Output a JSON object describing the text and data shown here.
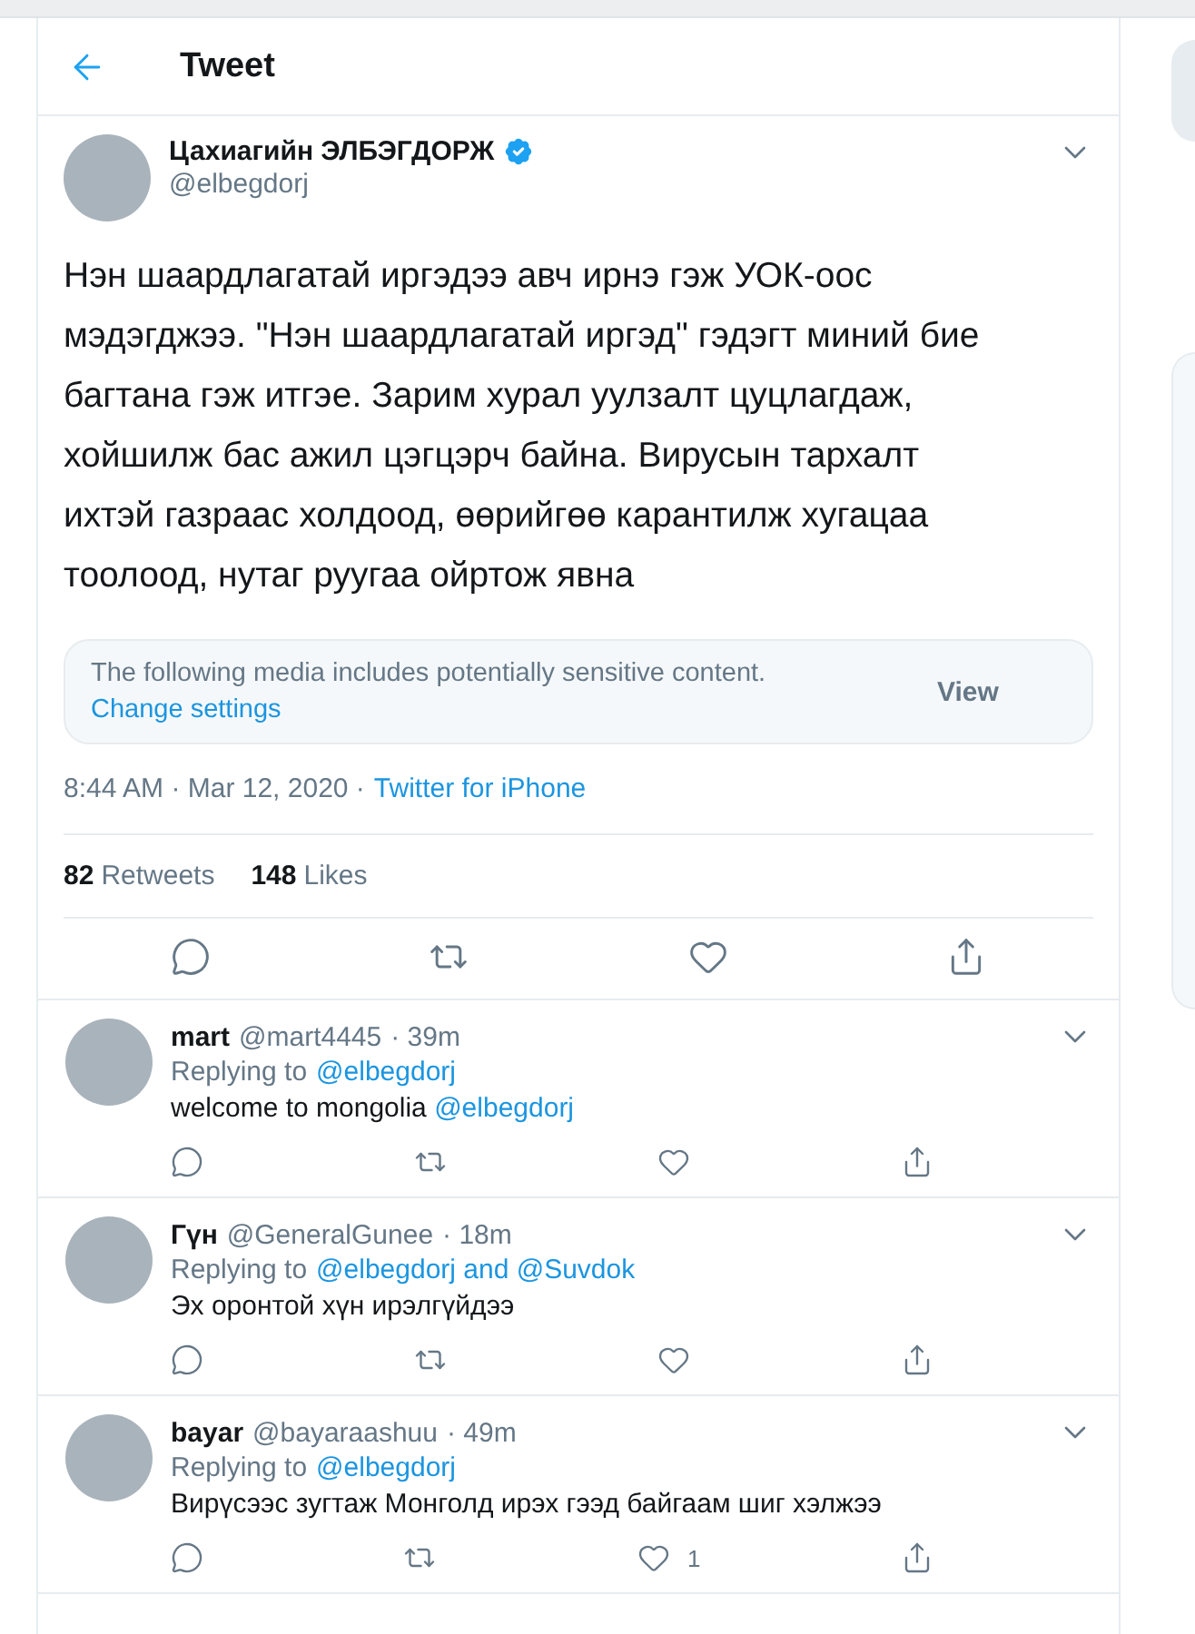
{
  "header": {
    "title": "Tweet"
  },
  "tweet": {
    "author": {
      "name": "Цахиагийн ЭЛБЭГДОРЖ",
      "handle": "@elbegdorj",
      "verified": true
    },
    "text": "Нэн шаардлагатай иргэдээ авч ирнэ гэж УОК-оос мэдэгджээ. \"Нэн шаардлагатай иргэд\" гэдэгт миний бие багтана гэж итгэе. Зарим хурал уулзалт цуцлагдаж, хойшилж бас ажил цэгцэрч байна. Вирусын тархалт ихтэй газраас холдоод, өөрийгөө карантилж хугацаа тоолоод, нутаг руугаа ойртож явна",
    "media_notice": {
      "text": "The following media includes potentially sensitive content.",
      "link": "Change settings",
      "button": "View"
    },
    "timestamp": "8:44 AM · Mar 12, 2020 ·",
    "source": "Twitter for iPhone",
    "stats": [
      {
        "count": "82",
        "label": "Retweets"
      },
      {
        "count": "148",
        "label": "Likes"
      }
    ]
  },
  "replies": [
    {
      "name": "mart",
      "handle": "@mart4445",
      "time": "· 39m",
      "replying_prefix": "Replying to",
      "replying_to": "@elbegdorj",
      "text": "welcome to mongolia",
      "mention": "@elbegdorj"
    },
    {
      "name": "Гүн",
      "handle": "@GeneralGunee",
      "time": "· 18m",
      "replying_prefix": "Replying to",
      "replying_to": "@elbegdorj and @Suvdok",
      "text": "Эх оронтой хүн ирэлгүйдээ"
    },
    {
      "name": "bayar",
      "handle": "@bayaraashuu",
      "time": "· 49m",
      "replying_prefix": "Replying to",
      "replying_to": "@elbegdorj",
      "text": "Вирүсээс зугтаж Монголд ирэх гээд байгаам шиг хэлжээ",
      "like_count": "1"
    }
  ]
}
